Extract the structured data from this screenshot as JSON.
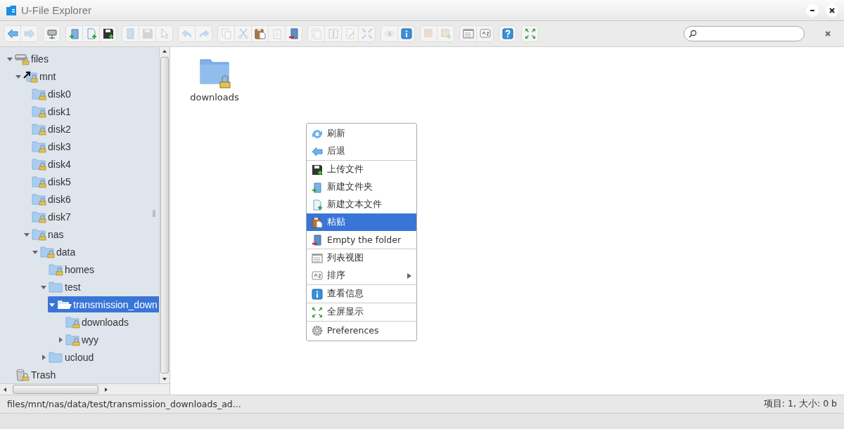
{
  "window": {
    "title": "U-File Explorer"
  },
  "toolbar": [
    [
      {
        "kind": "back",
        "disabled": false
      },
      {
        "kind": "forward",
        "disabled": true
      }
    ],
    [
      {
        "kind": "netmount",
        "disabled": false
      }
    ],
    [
      {
        "kind": "mkdir",
        "disabled": false
      },
      {
        "kind": "mkfile",
        "disabled": false
      },
      {
        "kind": "upload",
        "disabled": false
      }
    ],
    [
      {
        "kind": "open",
        "disabled": true
      },
      {
        "kind": "download",
        "disabled": true
      },
      {
        "kind": "select",
        "disabled": true
      }
    ],
    [
      {
        "kind": "undo",
        "disabled": true
      },
      {
        "kind": "redo",
        "disabled": true
      }
    ],
    [
      {
        "kind": "copy",
        "disabled": true
      },
      {
        "kind": "cut",
        "disabled": true
      },
      {
        "kind": "paste",
        "disabled": false
      },
      {
        "kind": "duplicate",
        "disabled": true
      },
      {
        "kind": "empty",
        "disabled": false
      }
    ],
    [
      {
        "kind": "copies",
        "disabled": true
      },
      {
        "kind": "selectbox",
        "disabled": true
      },
      {
        "kind": "edit",
        "disabled": true
      },
      {
        "kind": "resize",
        "disabled": true
      }
    ],
    [
      {
        "kind": "quicklook",
        "disabled": true
      },
      {
        "kind": "info",
        "disabled": false
      }
    ],
    [
      {
        "kind": "extract",
        "disabled": true
      },
      {
        "kind": "archive",
        "disabled": true
      }
    ],
    [
      {
        "kind": "listview",
        "disabled": false
      },
      {
        "kind": "sort",
        "disabled": false
      }
    ],
    [
      {
        "kind": "help",
        "disabled": false
      }
    ],
    [
      {
        "kind": "fullscreen",
        "disabled": false
      }
    ]
  ],
  "tree": [
    {
      "label": "files",
      "kind": "drive",
      "locked": true,
      "expanded": true,
      "selected": false,
      "children": [
        {
          "label": "mnt",
          "kind": "link",
          "locked": true,
          "expanded": true,
          "selected": false,
          "children": [
            {
              "label": "disk0",
              "kind": "folder",
              "locked": true,
              "selected": false
            },
            {
              "label": "disk1",
              "kind": "folder",
              "locked": true,
              "selected": false
            },
            {
              "label": "disk2",
              "kind": "folder",
              "locked": true,
              "selected": false
            },
            {
              "label": "disk3",
              "kind": "folder",
              "locked": true,
              "selected": false
            },
            {
              "label": "disk4",
              "kind": "folder",
              "locked": true,
              "selected": false
            },
            {
              "label": "disk5",
              "kind": "folder",
              "locked": true,
              "selected": false
            },
            {
              "label": "disk6",
              "kind": "folder",
              "locked": true,
              "selected": false
            },
            {
              "label": "disk7",
              "kind": "folder",
              "locked": true,
              "selected": false
            },
            {
              "label": "nas",
              "kind": "folder",
              "locked": true,
              "expanded": true,
              "selected": false,
              "children": [
                {
                  "label": "data",
                  "kind": "folder",
                  "locked": true,
                  "expanded": true,
                  "selected": false,
                  "children": [
                    {
                      "label": "homes",
                      "kind": "folder",
                      "locked": true,
                      "selected": false
                    },
                    {
                      "label": "test",
                      "kind": "folder",
                      "locked": false,
                      "expanded": true,
                      "selected": false,
                      "children": [
                        {
                          "label": "transmission_down",
                          "kind": "folder",
                          "locked": false,
                          "expanded": true,
                          "selected": true,
                          "children": [
                            {
                              "label": "downloads",
                              "kind": "folder",
                              "locked": true,
                              "selected": false
                            },
                            {
                              "label": "wyy",
                              "kind": "folder",
                              "locked": true,
                              "expanded": false,
                              "selected": false
                            }
                          ]
                        }
                      ]
                    },
                    {
                      "label": "ucloud",
                      "kind": "folder",
                      "locked": false,
                      "expanded": false,
                      "selected": false
                    }
                  ]
                }
              ]
            }
          ]
        }
      ]
    },
    {
      "label": "Trash",
      "kind": "trash",
      "locked": true,
      "selected": false
    }
  ],
  "files": [
    {
      "name": "downloads",
      "locked": true
    }
  ],
  "context_menu": [
    [
      {
        "kind": "reload",
        "label": "刷新",
        "selected": false
      },
      {
        "kind": "back",
        "label": "后退",
        "selected": false
      }
    ],
    [
      {
        "kind": "upload",
        "label": "上传文件",
        "selected": false
      },
      {
        "kind": "mkdir",
        "label": "新建文件夹",
        "selected": false
      },
      {
        "kind": "mkfile",
        "label": "新建文本文件",
        "selected": false
      },
      {
        "kind": "paste",
        "label": "粘贴",
        "selected": true
      },
      {
        "kind": "empty",
        "label": "Empty the folder",
        "selected": false
      }
    ],
    [
      {
        "kind": "listview",
        "label": "列表视图",
        "selected": false
      },
      {
        "kind": "sort",
        "label": "排序",
        "selected": false,
        "submenu": true
      }
    ],
    [
      {
        "kind": "info",
        "label": "查看信息",
        "selected": false
      }
    ],
    [
      {
        "kind": "fullscreen",
        "label": "全屏显示",
        "selected": false
      }
    ],
    [
      {
        "kind": "preferences",
        "label": "Preferences",
        "selected": false
      }
    ]
  ],
  "status_bar": {
    "path": "files/mnt/nas/data/test/transmission_downloads_ad...",
    "summary": "项目: 1, 大小: 0 b"
  }
}
